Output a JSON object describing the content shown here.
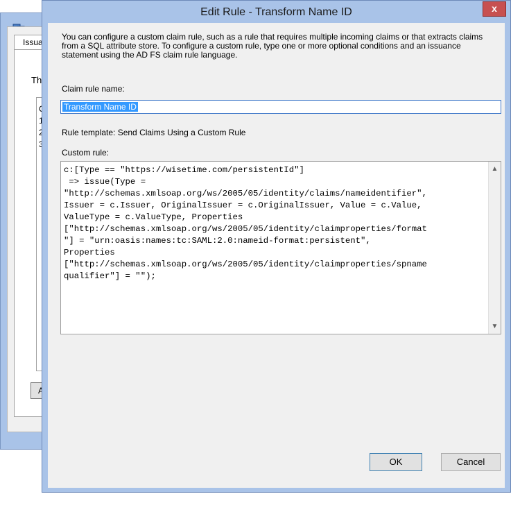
{
  "background_window": {
    "tab_label": "Issua",
    "text": "Th",
    "list_rows": [
      "C",
      "1",
      "2",
      "3"
    ],
    "button_label": "A",
    "right_fragments": [
      "-",
      "-",
      "-",
      "-"
    ]
  },
  "dialog": {
    "title": "Edit Rule - Transform Name ID",
    "close_label": "x",
    "description": "You can configure a custom claim rule, such as a rule that requires multiple incoming claims or that extracts claims from a SQL attribute store. To configure a custom rule, type one or more optional conditions and an issuance statement using the AD FS claim rule language.",
    "claim_rule_name_label": "Claim rule name:",
    "claim_rule_name_value": "Transform Name ID",
    "rule_template_label": "Rule template: Send Claims Using a Custom Rule",
    "custom_rule_label": "Custom rule:",
    "custom_rule_text": "c:[Type == \"https://wisetime.com/persistentId\"]\n => issue(Type =\n\"http://schemas.xmlsoap.org/ws/2005/05/identity/claims/nameidentifier\",\nIssuer = c.Issuer, OriginalIssuer = c.OriginalIssuer, Value = c.Value,\nValueType = c.ValueType, Properties\n[\"http://schemas.xmlsoap.org/ws/2005/05/identity/claimproperties/format\n\"] = \"urn:oasis:names:tc:SAML:2.0:nameid-format:persistent\",\nProperties\n[\"http://schemas.xmlsoap.org/ws/2005/05/identity/claimproperties/spname\nqualifier\"] = \"\");",
    "ok_label": "OK",
    "cancel_label": "Cancel"
  }
}
